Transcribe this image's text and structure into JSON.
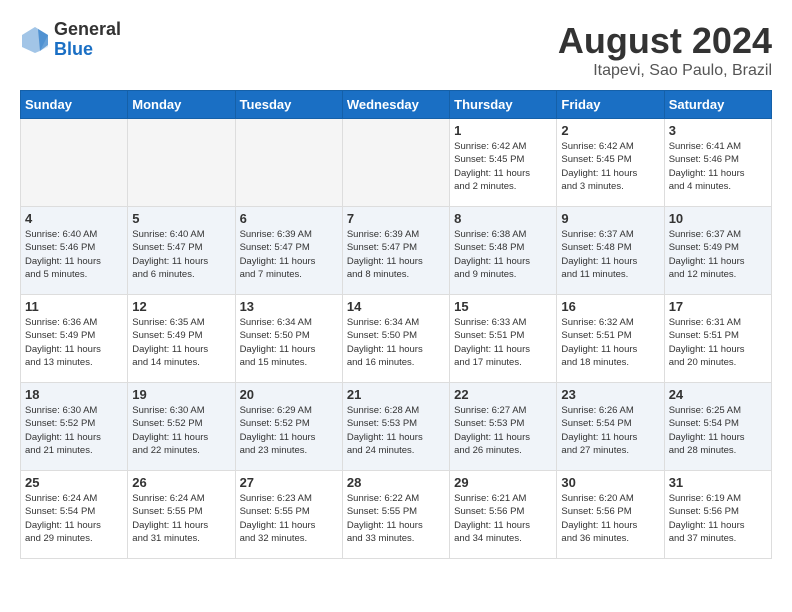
{
  "header": {
    "logo_general": "General",
    "logo_blue": "Blue",
    "month_title": "August 2024",
    "location": "Itapevi, Sao Paulo, Brazil"
  },
  "weekdays": [
    "Sunday",
    "Monday",
    "Tuesday",
    "Wednesday",
    "Thursday",
    "Friday",
    "Saturday"
  ],
  "weeks": [
    [
      {
        "day": "",
        "info": ""
      },
      {
        "day": "",
        "info": ""
      },
      {
        "day": "",
        "info": ""
      },
      {
        "day": "",
        "info": ""
      },
      {
        "day": "1",
        "info": "Sunrise: 6:42 AM\nSunset: 5:45 PM\nDaylight: 11 hours\nand 2 minutes."
      },
      {
        "day": "2",
        "info": "Sunrise: 6:42 AM\nSunset: 5:45 PM\nDaylight: 11 hours\nand 3 minutes."
      },
      {
        "day": "3",
        "info": "Sunrise: 6:41 AM\nSunset: 5:46 PM\nDaylight: 11 hours\nand 4 minutes."
      }
    ],
    [
      {
        "day": "4",
        "info": "Sunrise: 6:40 AM\nSunset: 5:46 PM\nDaylight: 11 hours\nand 5 minutes."
      },
      {
        "day": "5",
        "info": "Sunrise: 6:40 AM\nSunset: 5:47 PM\nDaylight: 11 hours\nand 6 minutes."
      },
      {
        "day": "6",
        "info": "Sunrise: 6:39 AM\nSunset: 5:47 PM\nDaylight: 11 hours\nand 7 minutes."
      },
      {
        "day": "7",
        "info": "Sunrise: 6:39 AM\nSunset: 5:47 PM\nDaylight: 11 hours\nand 8 minutes."
      },
      {
        "day": "8",
        "info": "Sunrise: 6:38 AM\nSunset: 5:48 PM\nDaylight: 11 hours\nand 9 minutes."
      },
      {
        "day": "9",
        "info": "Sunrise: 6:37 AM\nSunset: 5:48 PM\nDaylight: 11 hours\nand 11 minutes."
      },
      {
        "day": "10",
        "info": "Sunrise: 6:37 AM\nSunset: 5:49 PM\nDaylight: 11 hours\nand 12 minutes."
      }
    ],
    [
      {
        "day": "11",
        "info": "Sunrise: 6:36 AM\nSunset: 5:49 PM\nDaylight: 11 hours\nand 13 minutes."
      },
      {
        "day": "12",
        "info": "Sunrise: 6:35 AM\nSunset: 5:49 PM\nDaylight: 11 hours\nand 14 minutes."
      },
      {
        "day": "13",
        "info": "Sunrise: 6:34 AM\nSunset: 5:50 PM\nDaylight: 11 hours\nand 15 minutes."
      },
      {
        "day": "14",
        "info": "Sunrise: 6:34 AM\nSunset: 5:50 PM\nDaylight: 11 hours\nand 16 minutes."
      },
      {
        "day": "15",
        "info": "Sunrise: 6:33 AM\nSunset: 5:51 PM\nDaylight: 11 hours\nand 17 minutes."
      },
      {
        "day": "16",
        "info": "Sunrise: 6:32 AM\nSunset: 5:51 PM\nDaylight: 11 hours\nand 18 minutes."
      },
      {
        "day": "17",
        "info": "Sunrise: 6:31 AM\nSunset: 5:51 PM\nDaylight: 11 hours\nand 20 minutes."
      }
    ],
    [
      {
        "day": "18",
        "info": "Sunrise: 6:30 AM\nSunset: 5:52 PM\nDaylight: 11 hours\nand 21 minutes."
      },
      {
        "day": "19",
        "info": "Sunrise: 6:30 AM\nSunset: 5:52 PM\nDaylight: 11 hours\nand 22 minutes."
      },
      {
        "day": "20",
        "info": "Sunrise: 6:29 AM\nSunset: 5:52 PM\nDaylight: 11 hours\nand 23 minutes."
      },
      {
        "day": "21",
        "info": "Sunrise: 6:28 AM\nSunset: 5:53 PM\nDaylight: 11 hours\nand 24 minutes."
      },
      {
        "day": "22",
        "info": "Sunrise: 6:27 AM\nSunset: 5:53 PM\nDaylight: 11 hours\nand 26 minutes."
      },
      {
        "day": "23",
        "info": "Sunrise: 6:26 AM\nSunset: 5:54 PM\nDaylight: 11 hours\nand 27 minutes."
      },
      {
        "day": "24",
        "info": "Sunrise: 6:25 AM\nSunset: 5:54 PM\nDaylight: 11 hours\nand 28 minutes."
      }
    ],
    [
      {
        "day": "25",
        "info": "Sunrise: 6:24 AM\nSunset: 5:54 PM\nDaylight: 11 hours\nand 29 minutes."
      },
      {
        "day": "26",
        "info": "Sunrise: 6:24 AM\nSunset: 5:55 PM\nDaylight: 11 hours\nand 31 minutes."
      },
      {
        "day": "27",
        "info": "Sunrise: 6:23 AM\nSunset: 5:55 PM\nDaylight: 11 hours\nand 32 minutes."
      },
      {
        "day": "28",
        "info": "Sunrise: 6:22 AM\nSunset: 5:55 PM\nDaylight: 11 hours\nand 33 minutes."
      },
      {
        "day": "29",
        "info": "Sunrise: 6:21 AM\nSunset: 5:56 PM\nDaylight: 11 hours\nand 34 minutes."
      },
      {
        "day": "30",
        "info": "Sunrise: 6:20 AM\nSunset: 5:56 PM\nDaylight: 11 hours\nand 36 minutes."
      },
      {
        "day": "31",
        "info": "Sunrise: 6:19 AM\nSunset: 5:56 PM\nDaylight: 11 hours\nand 37 minutes."
      }
    ]
  ]
}
